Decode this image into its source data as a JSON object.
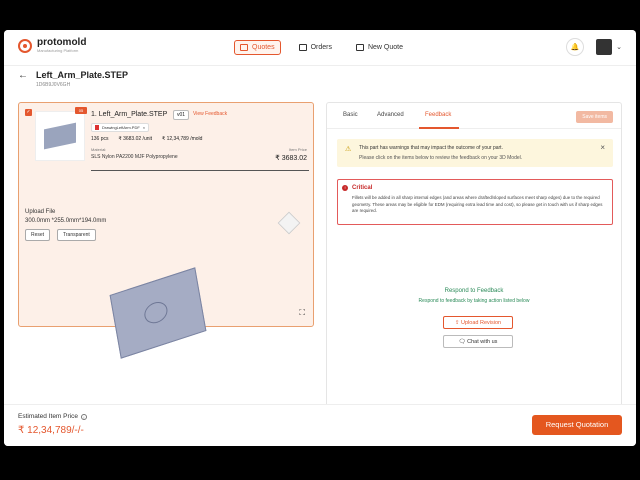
{
  "app": {
    "name": "protomold",
    "tagline": "Manufacturing Platform"
  },
  "nav": {
    "items": [
      {
        "label": "Quotes",
        "active": true
      },
      {
        "label": "Orders",
        "active": false
      },
      {
        "label": "New Quote",
        "active": false
      }
    ]
  },
  "page": {
    "title": "Left_Arm_Plate.STEP",
    "id": "1D6B9J0V6GH"
  },
  "part": {
    "badge": "05",
    "name": "1. Left_Arm_Plate.STEP",
    "version": "v01",
    "view_feedback": "View Feedback",
    "file_chip": "DrawingLeftArm.PDF",
    "qty": "136 pcs",
    "unit_price": "₹ 3683.02 /unit",
    "mold_price": "₹ 12,34,789 /mold",
    "material_label": "Material:",
    "material_value": "SLS Nylon PA2200 MJF Polypropylene",
    "item_price_label": "Item Price",
    "item_price_value": "₹ 3683.02"
  },
  "viewer": {
    "upload_label": "Upload File",
    "dimensions": "300.0mm *255.0mm*194.0mm",
    "reset": "Reset",
    "transparent": "Transparent"
  },
  "tabs": {
    "basic": "Basic",
    "advanced": "Advanced",
    "feedback": "Feedback",
    "save": "Save items"
  },
  "warning": {
    "title": "This part has warnings that may impact the outcome of your part.",
    "subtitle": "Please click on the items below to review the feedback on your 3D Model."
  },
  "critical": {
    "title": "Critical",
    "text": "Fillets will be added in all sharp internal edges (and areas where drafted/sloped surfaces meet sharp edges) due to the required geometry. These areas may be eligible for EDM (requiring extra lead time and cost), so please get in touch with us if sharp edges are required."
  },
  "respond": {
    "title": "Respond to Feedback",
    "subtitle": "Respond to feedback by taking action listed below",
    "upload": "Upload Revision",
    "chat": "Chat with us"
  },
  "footer": {
    "est_label": "Estimated Item Price",
    "est_value": "₹ 12,34,789/-/-",
    "request": "Request Quotation"
  },
  "colors": {
    "accent": "#e4572e",
    "critical": "#c62828",
    "success": "#2a8a58",
    "warning_bg": "#fdf6dd"
  },
  "icons": [
    "back-arrow-icon",
    "bell-icon",
    "chevron-down-icon",
    "warning-icon",
    "close-icon",
    "critical-icon",
    "upload-icon",
    "chat-icon",
    "fullscreen-icon",
    "info-icon",
    "view-cube-icon",
    "pdf-icon"
  ]
}
